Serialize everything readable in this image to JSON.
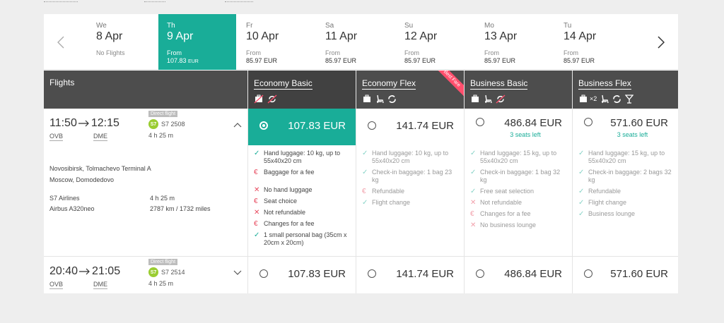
{
  "dates": [
    {
      "dow": "We",
      "day": "8 Apr",
      "status": "No Flights"
    },
    {
      "dow": "Th",
      "day": "9 Apr",
      "from": "From",
      "price": "107.83",
      "cur": "EUR"
    },
    {
      "dow": "Fr",
      "day": "10 Apr",
      "from": "From",
      "price": "85.97 EUR"
    },
    {
      "dow": "Sa",
      "day": "11 Apr",
      "from": "From",
      "price": "85.97 EUR"
    },
    {
      "dow": "Su",
      "day": "12 Apr",
      "from": "From",
      "price": "85.97 EUR"
    },
    {
      "dow": "Mo",
      "day": "13 Apr",
      "from": "From",
      "price": "85.97 EUR"
    },
    {
      "dow": "Tu",
      "day": "14 Apr",
      "from": "From",
      "price": "85.97 EUR"
    }
  ],
  "header": {
    "flights": "Flights",
    "fares": [
      "Economy Basic",
      "Economy Flex",
      "Business Basic",
      "Business Flex"
    ],
    "ribbon": "Best Fare",
    "x2": "×2"
  },
  "flight1": {
    "dep": "11:50",
    "arr": "12:15",
    "dep_code": "OVB",
    "arr_code": "DME",
    "badge": "Direct flight",
    "logo": "S7",
    "number": "S7 2508",
    "duration": "4 h 25 m",
    "from_airport": "Novosibirsk, Tolmachevo Terminal A",
    "to_airport": "Moscow, Domodedovo",
    "airline": "S7 Airlines",
    "leg_duration": "4 h 25 m",
    "aircraft": "Airbus A320neo",
    "distance": "2787 km / 1732 miles",
    "prices": [
      "107.83 EUR",
      "141.74 EUR",
      "486.84 EUR",
      "571.60 EUR"
    ],
    "seats": [
      "3 seats left",
      "3 seats left"
    ]
  },
  "flight2": {
    "dep": "20:40",
    "arr": "21:05",
    "dep_code": "OVB",
    "arr_code": "DME",
    "badge": "Direct flight",
    "logo": "S7",
    "number": "S7 2514",
    "duration": "4 h 25 m",
    "prices": [
      "107.83 EUR",
      "141.74 EUR",
      "486.84 EUR",
      "571.60 EUR"
    ]
  },
  "features": {
    "economy_basic": [
      {
        "icon": "check",
        "text": "Hand luggage: 10 kg, up to 55x40x20 cm"
      },
      {
        "icon": "euro",
        "text": "Baggage for a fee"
      },
      {
        "icon": "cross",
        "text": "No hand luggage",
        "gap": true
      },
      {
        "icon": "euro",
        "text": "Seat choice"
      },
      {
        "icon": "cross",
        "text": "Not refundable"
      },
      {
        "icon": "euro",
        "text": "Changes for a fee"
      },
      {
        "icon": "check",
        "text": "1 small personal bag (35cm x 20cm x 20cm)"
      }
    ],
    "economy_flex": [
      {
        "icon": "check",
        "text": "Hand luggage: 10 kg, up to 55x40x20 cm"
      },
      {
        "icon": "check",
        "text": "Check-in baggage: 1 bag 23 kg"
      },
      {
        "icon": "euro",
        "text": "Refundable"
      },
      {
        "icon": "check",
        "text": "Flight change"
      }
    ],
    "business_basic": [
      {
        "icon": "check",
        "text": "Hand luggage: 15 kg, up to 55x40x20 cm"
      },
      {
        "icon": "check",
        "text": "Check-in baggage: 1 bag 32 kg"
      },
      {
        "icon": "check",
        "text": "Free seat selection"
      },
      {
        "icon": "cross",
        "text": "Not refundable"
      },
      {
        "icon": "euro",
        "text": "Changes for a fee"
      },
      {
        "icon": "cross",
        "text": "No business lounge"
      }
    ],
    "business_flex": [
      {
        "icon": "check",
        "text": "Hand luggage: 15 kg, up to 55x40x20 cm"
      },
      {
        "icon": "check",
        "text": "Check-in baggage: 2 bags 32 kg"
      },
      {
        "icon": "check",
        "text": "Refundable"
      },
      {
        "icon": "check",
        "text": "Flight change"
      },
      {
        "icon": "check",
        "text": "Business lounge"
      }
    ]
  },
  "colors": {
    "accent": "#19ad98",
    "header": "#4d4d4d",
    "ribbon": "#ff4f6d",
    "negative": "#e84a5f"
  }
}
